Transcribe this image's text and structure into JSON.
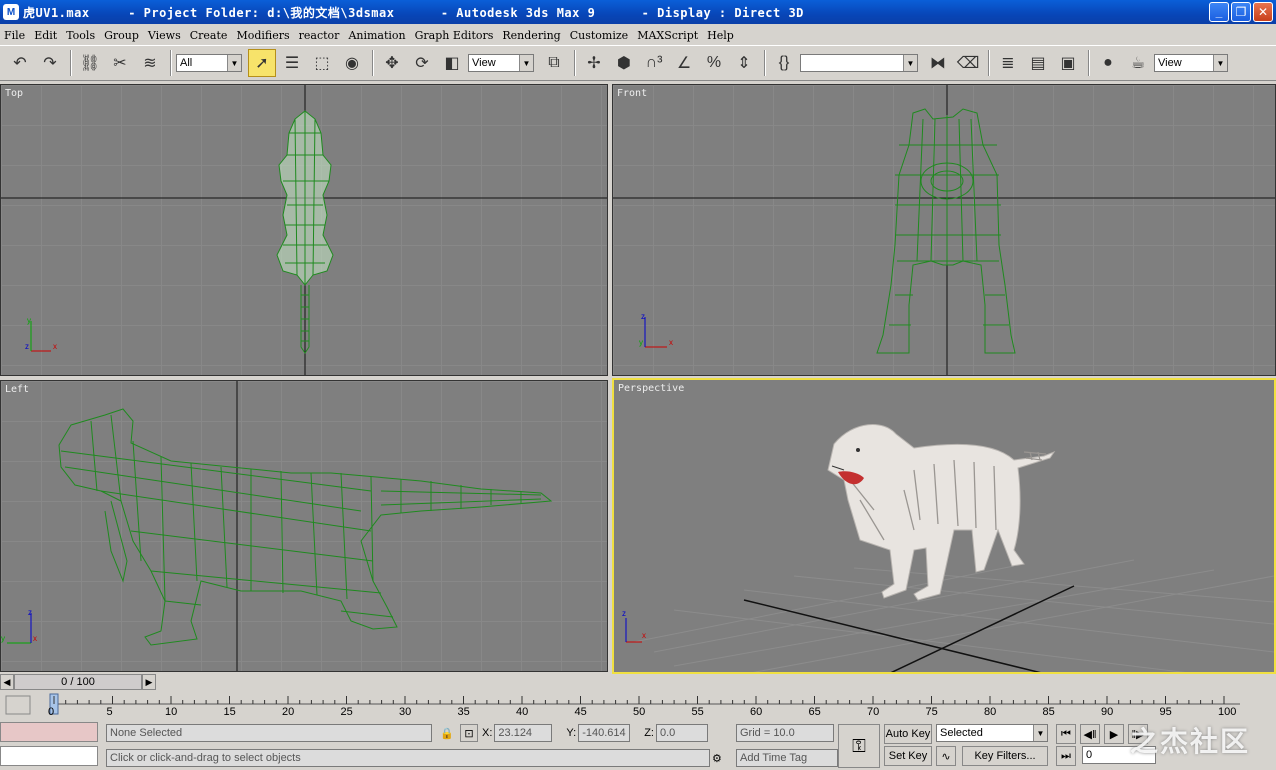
{
  "window": {
    "title": "虎UV1.max     - Project Folder: d:\\我的文档\\3dsmax      - Autodesk 3ds Max 9      - Display : Direct 3D"
  },
  "menu": [
    "File",
    "Edit",
    "Tools",
    "Group",
    "Views",
    "Create",
    "Modifiers",
    "reactor",
    "Animation",
    "Graph Editors",
    "Rendering",
    "Customize",
    "MAXScript",
    "Help"
  ],
  "toolbar": {
    "selection_filter": "All",
    "ref_coord": "View",
    "named_selection": "",
    "render_type": "View"
  },
  "viewports": {
    "top": "Top",
    "front": "Front",
    "left": "Left",
    "perspective": "Perspective"
  },
  "axes": {
    "x": "x",
    "y": "y",
    "z": "z"
  },
  "timeline": {
    "frame_counter": "0 / 100",
    "ticks": [
      "0",
      "5",
      "10",
      "15",
      "20",
      "25",
      "30",
      "35",
      "40",
      "45",
      "50",
      "55",
      "60",
      "65",
      "70",
      "75",
      "80",
      "85",
      "90",
      "95",
      "100"
    ]
  },
  "status": {
    "selection": "None Selected",
    "prompt": "Click or click-and-drag to select objects",
    "x_label": "X:",
    "x_value": "23.124",
    "y_label": "Y:",
    "y_value": "-140.614",
    "z_label": "Z:",
    "z_value": "0.0",
    "grid": "Grid = 10.0",
    "add_time_tag": "Add Time Tag",
    "auto_key": "Auto Key",
    "set_key": "Set Key",
    "key_mode": "Selected",
    "key_filters": "Key Filters...",
    "current_frame": "0"
  },
  "watermark": "之杰社区",
  "colors": {
    "wireframe": "#1f8a1f",
    "viewport_bg": "#7f7f7f",
    "active_viewport_border": "#f0e040",
    "titlebar": "#0a4fc8"
  }
}
